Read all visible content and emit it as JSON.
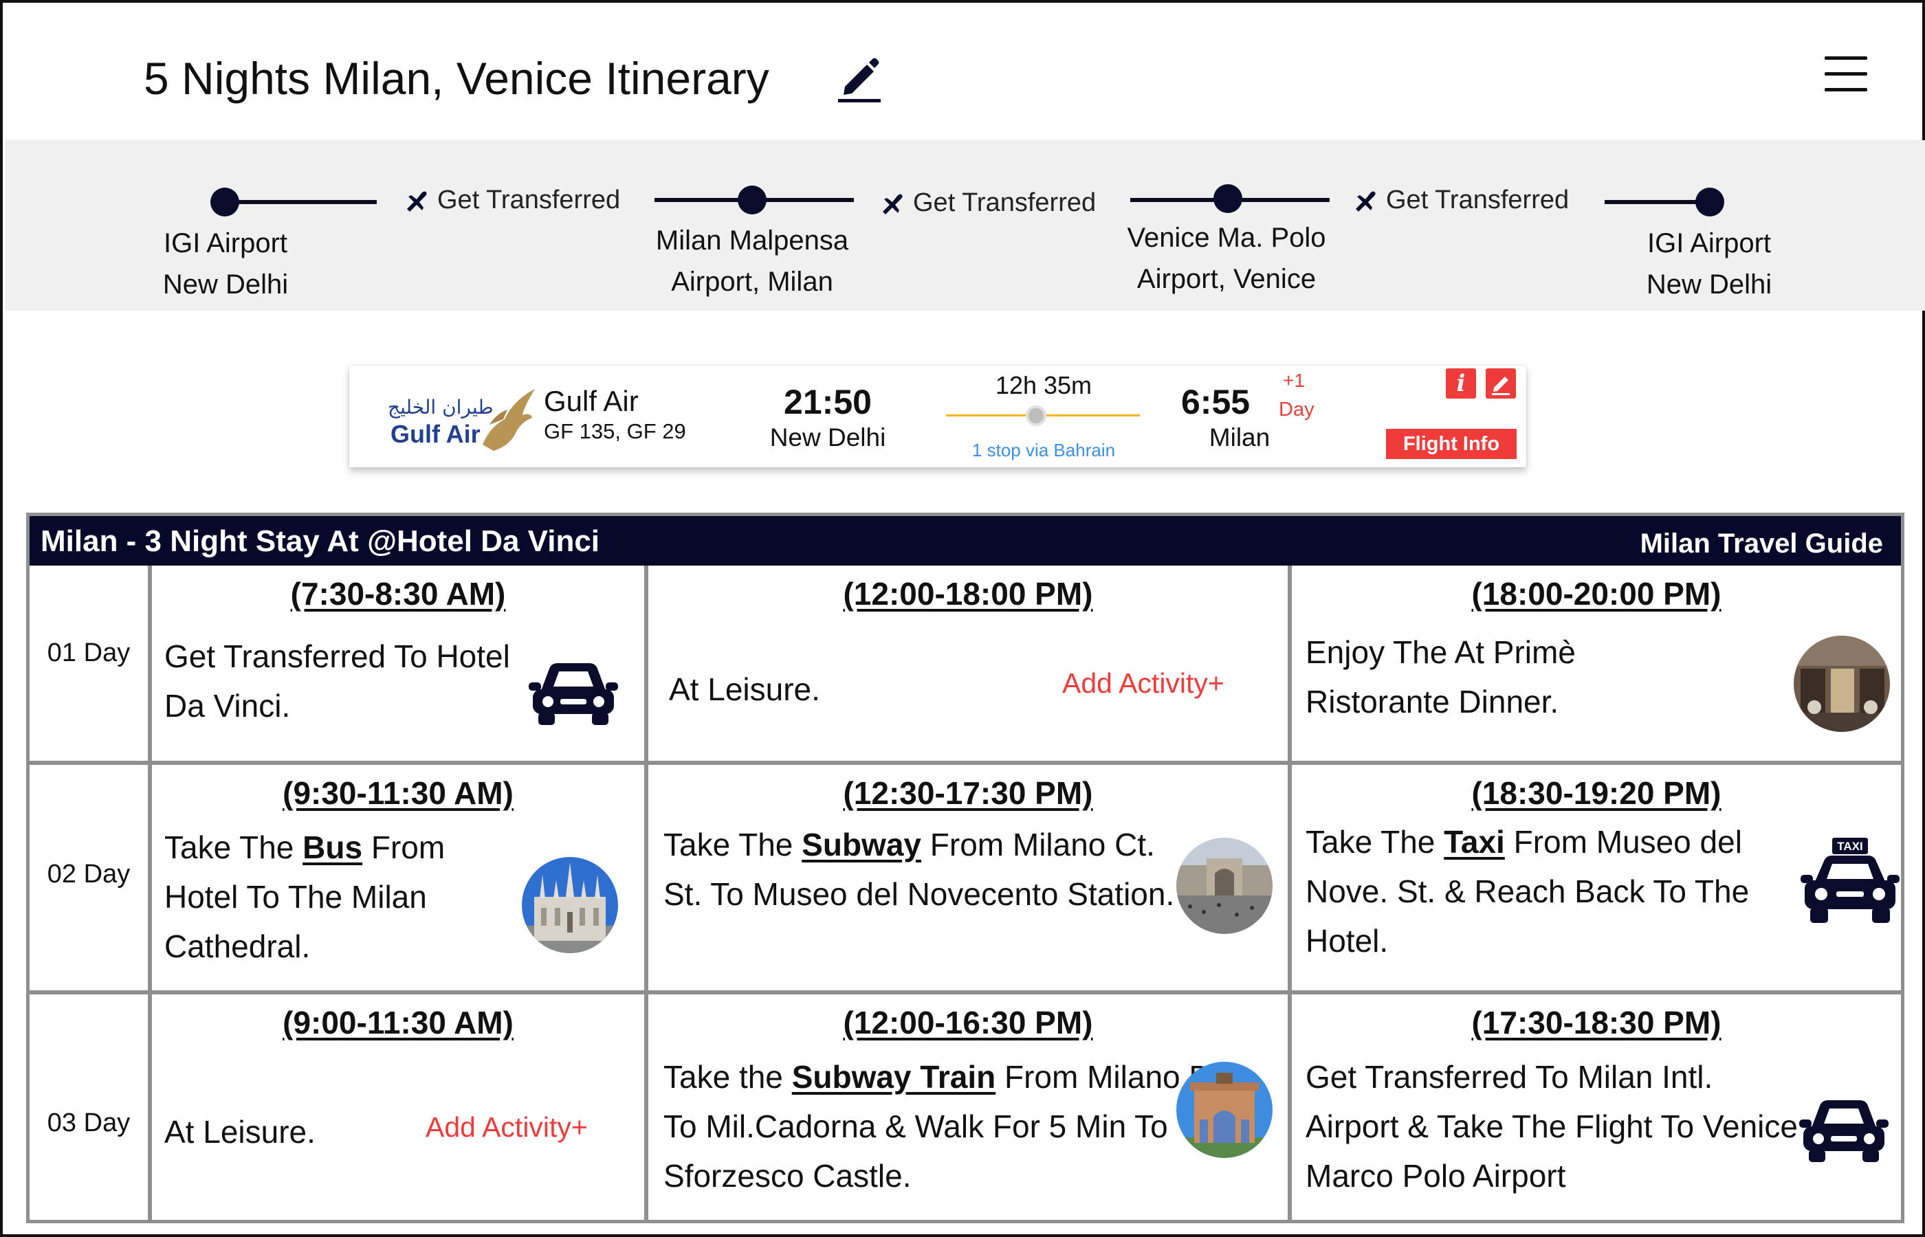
{
  "header": {
    "title": "5 Nights Milan, Venice Itinerary"
  },
  "route": {
    "stops": [
      {
        "line1": "IGI Airport",
        "line2": "New Delhi"
      },
      {
        "line1": "Milan Malpensa",
        "line2": "Airport, Milan"
      },
      {
        "line1": "Venice Ma. Polo",
        "line2": "Airport, Venice"
      },
      {
        "line1": "IGI Airport",
        "line2": "New Delhi"
      }
    ],
    "transfers": [
      "Get Transferred",
      "Get Transferred",
      "Get Transferred"
    ]
  },
  "flight": {
    "logo_arabic": "طيران الخليج",
    "logo_text": "Gulf Air",
    "airline": "Gulf Air",
    "flight_numbers": "GF 135, GF 29",
    "departure_time": "21:50",
    "departure_city": "New Delhi",
    "duration": "12h 35m",
    "stop_info": "1 stop via Bahrain",
    "arrival_time": "6:55",
    "arrival_offset": "+1",
    "arrival_offset_label": "Day",
    "arrival_city": "Milan",
    "info_button": "i",
    "flight_info_button": "Flight Info"
  },
  "stay": {
    "title": "Milan - 3 Night Stay At @Hotel Da Vinci",
    "guide_link": "Milan Travel Guide",
    "add_activity_label": "Add Activity+",
    "days": [
      {
        "label": "01 Day",
        "slots": [
          {
            "time": "(7:30-8:30 AM)",
            "text": "Get Transferred To Hotel Da Vinci."
          },
          {
            "time": "(12:00-18:00 PM)",
            "text": "At Leisure."
          },
          {
            "time": "(18:00-20:00 PM)",
            "text": "Enjoy The At Primè Ristorante Dinner."
          }
        ]
      },
      {
        "label": "02 Day",
        "slots": [
          {
            "time": "(9:30-11:30 AM)",
            "pre": "Take The ",
            "bold": "Bus",
            "post": " From Hotel To The Milan Cathedral."
          },
          {
            "time": "(12:30-17:30 PM)",
            "pre": "Take The ",
            "bold": "Subway",
            "post": " From Milano Ct. St. To Museo del Novecento Station."
          },
          {
            "time": "(18:30-19:20 PM)",
            "pre": "Take The ",
            "bold": "Taxi",
            "post": " From Museo del Nove. St. & Reach Back To The Hotel."
          }
        ]
      },
      {
        "label": "03 Day",
        "slots": [
          {
            "time": "(9:00-11:30 AM)",
            "text": "At Leisure."
          },
          {
            "time": "(12:00-16:30 PM)",
            "pre": "Take the ",
            "bold": "Subway Train",
            "post": " From Milano Br. To Mil.Cadorna & Walk For 5 Min To Sforzesco Castle."
          },
          {
            "time": "(17:30-18:30 PM)",
            "text": "Get Transferred To Milan Intl. Airport & Take The Flight To Venice Marco Polo Airport"
          }
        ]
      }
    ],
    "taxi_sign": "TAXI"
  },
  "colors": {
    "navy": "#07082a",
    "accent_red": "#f03b3b",
    "link_blue": "#3d8fe6",
    "duration_line": "#f3b818",
    "grid_gray": "#8f8f8f",
    "band_gray": "#f0f0f0"
  }
}
